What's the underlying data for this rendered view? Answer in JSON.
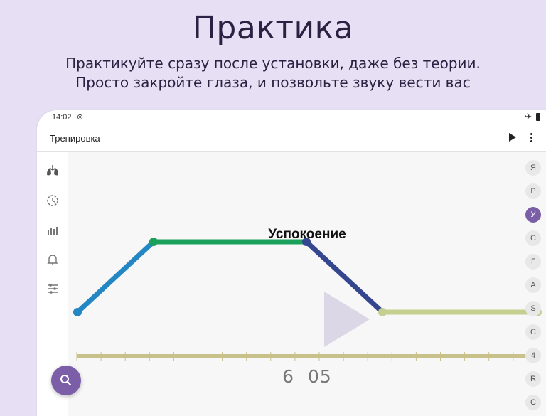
{
  "promo": {
    "headline": "Практика",
    "subtitle_line1": "Практикуйте сразу после установки, даже без теории.",
    "subtitle_line2": "Просто закройте глаза, и позвольте звуку вести вас"
  },
  "status_bar": {
    "time": "14:02"
  },
  "app_bar": {
    "title": "Тренировка"
  },
  "side_rail": {
    "icons": [
      "lungs-icon",
      "timer-icon",
      "bar-chart-icon",
      "bell-icon",
      "sliders-icon"
    ]
  },
  "exercise": {
    "title": "Успокоение",
    "timer_left": "6",
    "timer_right": "05"
  },
  "alphabet_index": {
    "letters": [
      "Я",
      "Р",
      "У",
      "С",
      "Г",
      "А",
      "S",
      "С",
      "4",
      "R",
      "С"
    ],
    "active": "У"
  },
  "colors": {
    "background": "#e7dff3",
    "accent": "#7b5ea7",
    "inhale": "#2387c3",
    "hold": "#1aa05a",
    "exhale": "#34468e",
    "rest": "#c4cf90",
    "timeline": "#c8c18a"
  }
}
